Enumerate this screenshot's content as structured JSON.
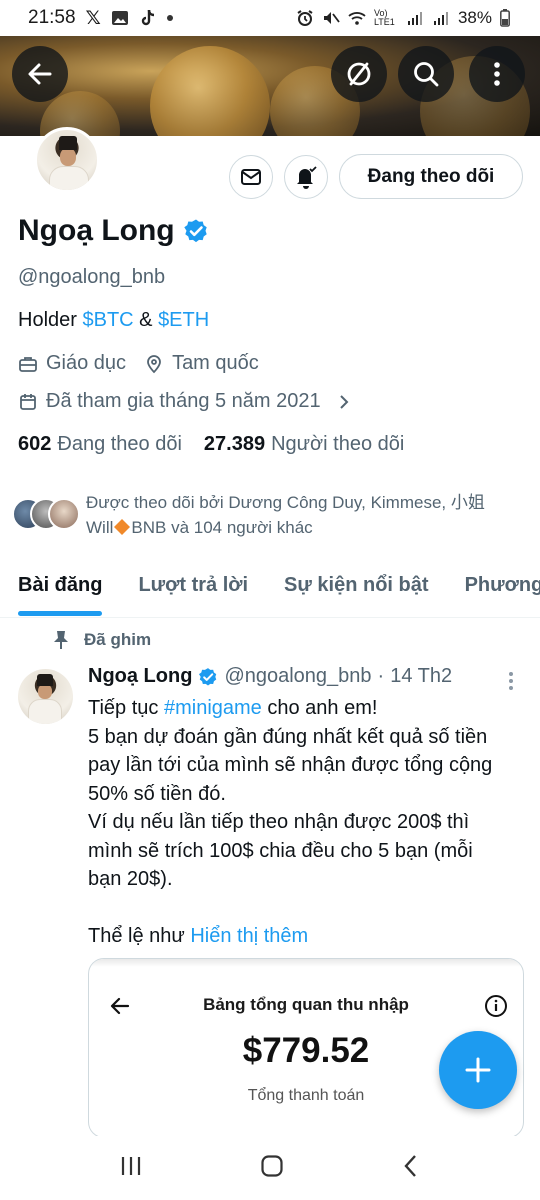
{
  "status_bar": {
    "time": "21:58",
    "lte_label": "Vo) LTE1",
    "battery": "38%"
  },
  "banner": {
    "back_icon": "arrow-left-icon",
    "grok_icon": "slash-circle-icon",
    "search_icon": "search-icon",
    "more_icon": "more-vertical-icon"
  },
  "profile": {
    "name": "Ngoạ Long",
    "handle": "@ngoalong_bnb",
    "bio_prefix": "Holder ",
    "bio_link1": "$BTC",
    "bio_middle": " & ",
    "bio_link2": "$ETH",
    "category": "Giáo dục",
    "location": "Tam quốc",
    "joined": "Đã tham gia tháng 5 năm 2021",
    "following_count": "602",
    "following_label": "Đang theo dõi",
    "followers_count": "27.389",
    "followers_label": "Người theo dõi",
    "followed_by_line1": "Được theo dõi bởi Dương Công Duy, Kimmese, 小姐",
    "followed_by_line2_a": "Will",
    "followed_by_line2_b": "BNB và 104 người khác",
    "follow_button": "Đang theo dõi",
    "accent": "#1d9bf0"
  },
  "tabs": [
    {
      "label": "Bài đăng",
      "active": true
    },
    {
      "label": "Lượt trả lời",
      "active": false
    },
    {
      "label": "Sự kiện nổi bật",
      "active": false
    },
    {
      "label": "Phương tiện",
      "active": false
    }
  ],
  "pinned_post": {
    "pinned_label": "Đã ghim",
    "author_name": "Ngoạ Long",
    "author_handle": "@ngoalong_bnb",
    "separator": "·",
    "date": "14 Th2",
    "line1_a": "Tiếp tục ",
    "line1_hashtag": "#minigame",
    "line1_b": " cho anh em!",
    "line2": "5 bạn dự đoán gần đúng nhất kết quả số tiền",
    "line3": "pay lần tới của mình sẽ nhận được tổng cộng",
    "line4": "50% số tiền đó.",
    "line5": "Ví dụ nếu lần tiếp theo nhận được 200$ thì",
    "line6": "mình sẽ trích 100$ chia đều cho 5 bạn (mỗi",
    "line7": "bạn 20$).",
    "line8_a": "Thể lệ như ",
    "line8_link": "Hiển thị thêm",
    "card": {
      "title": "Bảng tổng quan thu nhập",
      "amount": "$779.52",
      "subtitle": "Tổng thanh toán"
    }
  }
}
